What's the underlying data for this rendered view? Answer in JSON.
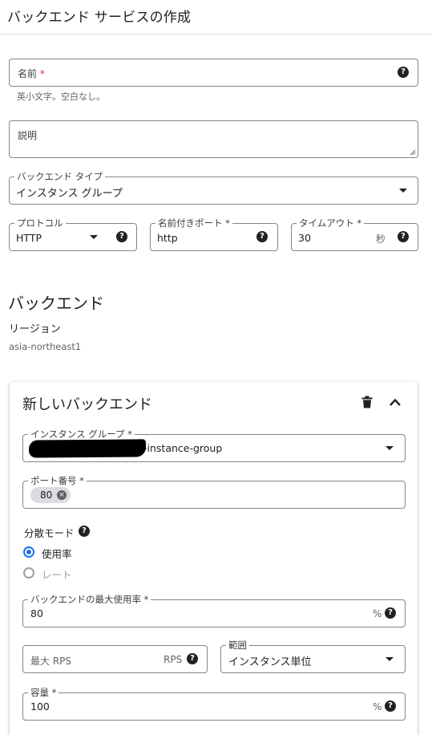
{
  "page": {
    "title": "バックエンド サービスの作成"
  },
  "name_field": {
    "label": "名前",
    "required_mark": "*",
    "hint": "英小文字。空白なし。"
  },
  "description_field": {
    "label": "説明"
  },
  "backend_type": {
    "label": "バックエンド タイプ",
    "value": "インスタンス グループ"
  },
  "protocol": {
    "label": "プロトコル",
    "value": "HTTP"
  },
  "named_port": {
    "label": "名前付きポート *",
    "value": "http"
  },
  "timeout": {
    "label": "タイムアウト *",
    "value": "30",
    "unit": "秒"
  },
  "backends_section": {
    "title": "バックエンド",
    "region_label": "リージョン",
    "region_value": "asia-northeast1"
  },
  "new_backend": {
    "title": "新しいバックエンド",
    "instance_group": {
      "label": "インスタンス グループ *",
      "value_suffix": "-instance-group"
    },
    "port_numbers": {
      "label": "ポート番号 *",
      "chips": [
        "80"
      ]
    },
    "balancing_mode": {
      "label": "分散モード",
      "options": [
        {
          "label": "使用率",
          "selected": true
        },
        {
          "label": "レート",
          "selected": false
        }
      ]
    },
    "max_utilization": {
      "label": "バックエンドの最大使用率 *",
      "value": "80",
      "unit": "%"
    },
    "max_rps": {
      "placeholder": "最大 RPS",
      "unit": "RPS"
    },
    "scope": {
      "label": "範囲",
      "value": "インスタンス単位"
    },
    "capacity": {
      "label": "容量 *",
      "value": "100",
      "unit": "%"
    }
  },
  "colors": {
    "accent": "#1a73e8",
    "required": "#d93025",
    "border": "#80868b",
    "text": "#202124",
    "muted": "#5f6368"
  },
  "icons": [
    "help-icon",
    "caret-down-icon",
    "trash-icon",
    "chevron-up-icon",
    "chip-remove-icon",
    "resize-handle-icon"
  ]
}
